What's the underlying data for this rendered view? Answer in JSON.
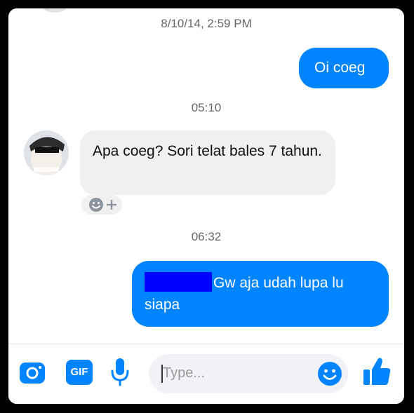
{
  "messages": {
    "timestamp1": "8/10/14, 2:59 PM",
    "out1": "Oi coeg",
    "timestamp2": "05:10",
    "in1": "Apa coeg? Sori telat bales 7 tahun.",
    "timestamp3": "06:32",
    "out2": "Gw aja udah lupa lu siapa"
  },
  "composer": {
    "placeholder": "Type...",
    "gif_label": "GIF"
  },
  "colors": {
    "accent": "#0084ff",
    "bubble_in": "#f1f0f0",
    "redaction": "#0000ff"
  },
  "icons": [
    "camera-icon",
    "gif-icon",
    "microphone-icon",
    "emoji-icon",
    "thumbs-up-icon",
    "add-reaction-icon"
  ]
}
